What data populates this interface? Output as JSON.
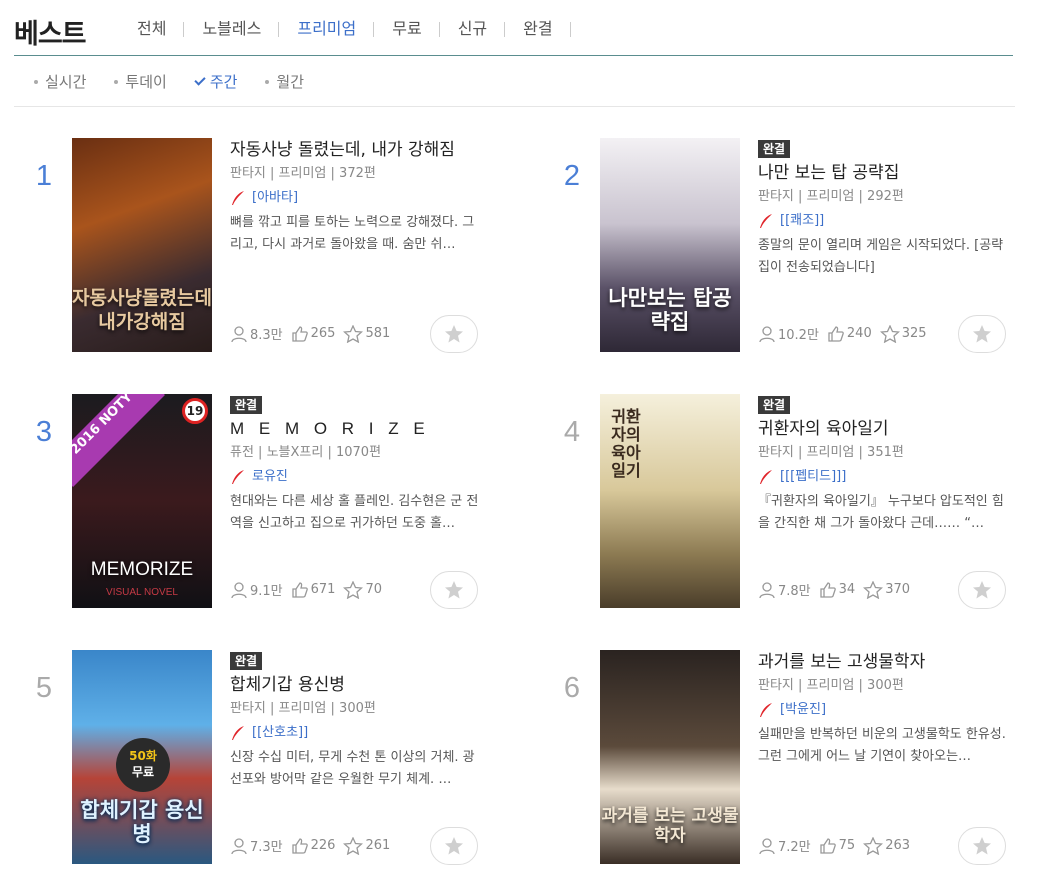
{
  "header": {
    "title": "베스트",
    "tabs": [
      {
        "label": "전체"
      },
      {
        "label": "노블레스"
      },
      {
        "label": "프리미엄"
      },
      {
        "label": "무료"
      },
      {
        "label": "신규"
      },
      {
        "label": "완결"
      }
    ]
  },
  "subtabs": [
    {
      "label": "실시간"
    },
    {
      "label": "투데이"
    },
    {
      "label": "주간"
    },
    {
      "label": "월간"
    }
  ],
  "colors": {
    "accent": "#3c6fc9",
    "rank_gray": "#aaaaaa",
    "badge_bg": "#3a3a3a"
  },
  "items": [
    {
      "rank": "1",
      "badge": "",
      "title": "자동사냥 돌렸는데, 내가 강해짐",
      "genre": "판타지",
      "category": "프리미엄",
      "episodes": "372편",
      "author": "[아바타]",
      "desc": "뼈를 깎고 피를 토하는 노력으로 강해졌다. 그리고, 다시 과거로 돌아왔을 때. 숨만 쉬…",
      "views": "8.3만",
      "likes": "265",
      "stars": "581",
      "cover_text": "자동사냥돌렸는데 내가강해짐"
    },
    {
      "rank": "2",
      "badge": "완결",
      "title": "나만 보는 탑 공략집",
      "genre": "판타지",
      "category": "프리미엄",
      "episodes": "292편",
      "author": "[[쾌조]]",
      "desc": "종말의 문이 열리며 게임은 시작되었다. [공략집이 전송되었습니다]",
      "views": "10.2만",
      "likes": "240",
      "stars": "325",
      "cover_text": "나만보는 탑공략집"
    },
    {
      "rank": "3",
      "badge": "완결",
      "title": "M E M O R I Z E",
      "genre": "퓨전",
      "category": "노블X프리",
      "episodes": "1070편",
      "author": "로유진",
      "desc": "현대와는 다른 세상 홀 플레인. 김수현은 군 전역을 신고하고 집으로 귀가하던 도중 홀…",
      "views": "9.1만",
      "likes": "671",
      "stars": "70",
      "cover_text": "MEMORIZE",
      "cover_sub": "VISUAL NOVEL",
      "noty": "2016 NOTY",
      "age": "19"
    },
    {
      "rank": "4",
      "badge": "완결",
      "title": "귀환자의 육아일기",
      "genre": "판타지",
      "category": "프리미엄",
      "episodes": "351편",
      "author": "[[[펩티드]]]",
      "desc": "『귀환자의 육아일기』 누구보다 압도적인 힘을 간직한 채 그가 돌아왔다 근데…… “…",
      "views": "7.8만",
      "likes": "34",
      "stars": "370",
      "cover_text": "귀환자의 육아일기"
    },
    {
      "rank": "5",
      "badge": "완결",
      "title": "합체기갑 용신병",
      "genre": "판타지",
      "category": "프리미엄",
      "episodes": "300편",
      "author": "[[산호초]]",
      "desc": "신장 수십 미터, 무게 수천 톤 이상의 거체. 광선포와 방어막 같은 우월한 무기 체계. …",
      "views": "7.3만",
      "likes": "226",
      "stars": "261",
      "cover_text": "합체기갑 용신병",
      "free_top": "50화",
      "free_bottom": "무료"
    },
    {
      "rank": "6",
      "badge": "",
      "title": "과거를 보는 고생물학자",
      "genre": "판타지",
      "category": "프리미엄",
      "episodes": "300편",
      "author": "[박윤진]",
      "desc": "실패만을 반복하던 비운의 고생물학도 한유성. 그런 그에게 어느 날 기연이 찾아오는…",
      "views": "7.2만",
      "likes": "75",
      "stars": "263",
      "cover_text": "과거를 보는 고생물학자"
    }
  ]
}
